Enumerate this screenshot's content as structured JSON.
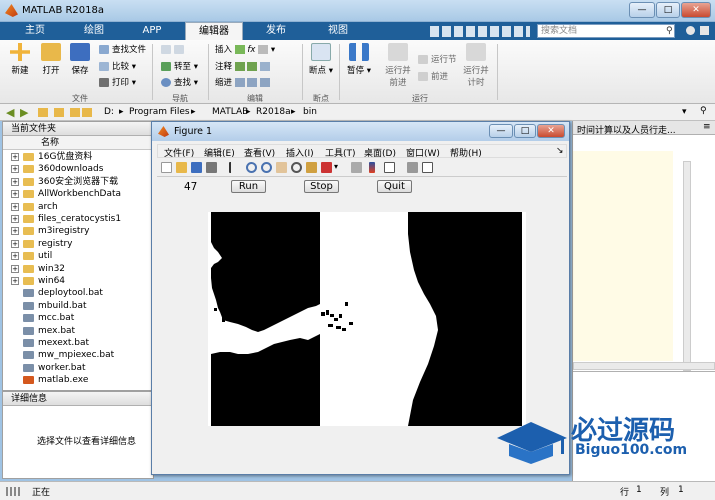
{
  "window": {
    "title": "MATLAB R2018a",
    "min": "—",
    "max": "□",
    "close": "✕"
  },
  "tabs": [
    {
      "label": "主页"
    },
    {
      "label": "绘图"
    },
    {
      "label": "APP"
    },
    {
      "label": "编辑器",
      "active": true
    },
    {
      "label": "发布"
    },
    {
      "label": "视图"
    }
  ],
  "search": {
    "placeholder": "搜索文档"
  },
  "ribbon": {
    "new": "新建",
    "open": "打开",
    "save": "保存",
    "find_files": "查找文件",
    "compare": "比较",
    "print": "打印",
    "goto": "转至",
    "find": "查找",
    "insert": "插入",
    "comment": "注释",
    "indent": "缩进",
    "breakpoint": "断点",
    "pause": "暂停",
    "run_advance": "运行并\n前进",
    "run_section": "运行节",
    "advance": "前进",
    "run_time": "运行并\n计时",
    "groups": {
      "file": "文件",
      "navigate": "导航",
      "edit": "编辑",
      "breakpoints": "断点",
      "run": "运行"
    }
  },
  "address": {
    "parts": [
      "D:",
      "Program Files",
      "MATLAB",
      "R2018a",
      "bin"
    ]
  },
  "current_folder": {
    "title": "当前文件夹",
    "col_name": "名称",
    "items": [
      {
        "name": "16G优盘资料",
        "type": "folder"
      },
      {
        "name": "360downloads",
        "type": "folder"
      },
      {
        "name": "360安全浏览器下载",
        "type": "folder"
      },
      {
        "name": "AllWorkbenchData",
        "type": "folder"
      },
      {
        "name": "arch",
        "type": "folder"
      },
      {
        "name": "files_ceratocystis1",
        "type": "folder"
      },
      {
        "name": "m3iregistry",
        "type": "folder"
      },
      {
        "name": "registry",
        "type": "folder"
      },
      {
        "name": "util",
        "type": "folder"
      },
      {
        "name": "win32",
        "type": "folder"
      },
      {
        "name": "win64",
        "type": "folder"
      },
      {
        "name": "deploytool.bat",
        "type": "bat"
      },
      {
        "name": "mbuild.bat",
        "type": "bat"
      },
      {
        "name": "mcc.bat",
        "type": "bat"
      },
      {
        "name": "mex.bat",
        "type": "bat"
      },
      {
        "name": "mexext.bat",
        "type": "bat"
      },
      {
        "name": "mw_mpiexec.bat",
        "type": "bat"
      },
      {
        "name": "worker.bat",
        "type": "bat"
      },
      {
        "name": "matlab.exe",
        "type": "exe"
      }
    ]
  },
  "details": {
    "title": "详细信息",
    "hint": "选择文件以查看详细信息"
  },
  "editor_tab": "时间计算以及人员行走...",
  "status": {
    "left": "正在",
    "row_label": "行",
    "row": "1",
    "col_label": "列",
    "col": "1"
  },
  "figure": {
    "title": "Figure 1",
    "menu": [
      "文件(F)",
      "编辑(E)",
      "查看(V)",
      "插入(I)",
      "工具(T)",
      "桌面(D)",
      "窗口(W)",
      "帮助(H)"
    ],
    "counter": "47",
    "run": "Run",
    "stop": "Stop",
    "quit": "Quit"
  },
  "watermark": {
    "text_cn": "必过源码",
    "text_en": "Biguo100.com",
    "color": "#1c5fae"
  }
}
